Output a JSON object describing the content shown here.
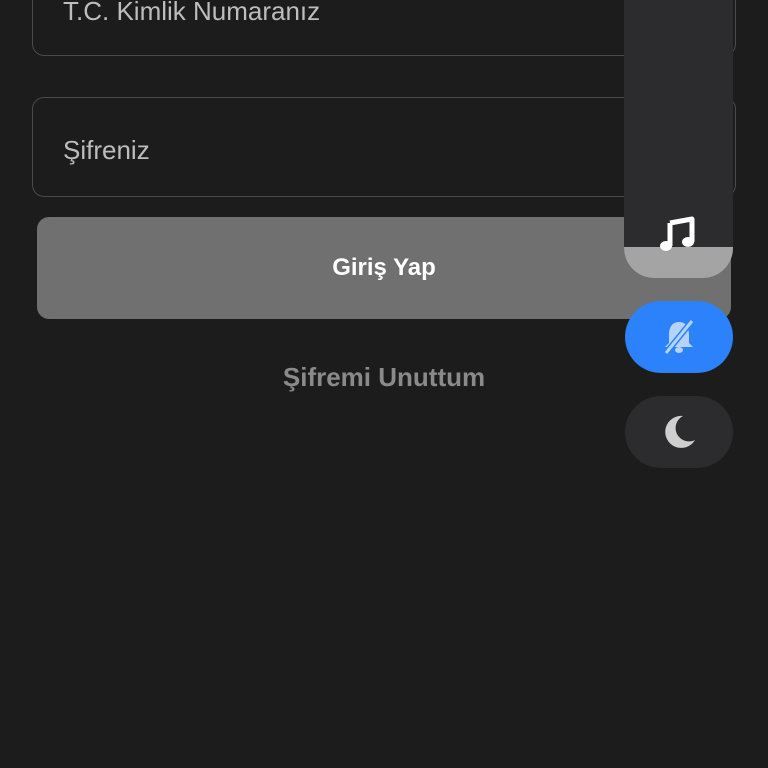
{
  "form": {
    "tc_placeholder": "T.C. Kimlik Numaranız",
    "password_placeholder": "Şifreniz",
    "login_label": "Giriş Yap",
    "forgot_label": "Şifremi Unuttum"
  },
  "sound_panel": {
    "volume_level": 0.1,
    "media_icon": "music-note-icon",
    "mute_icon": "bell-off-icon",
    "mute_active": true,
    "dnd_icon": "moon-icon"
  },
  "colors": {
    "background": "#1c1c1c",
    "login_button": "#707070",
    "active_accent": "#2b82fb",
    "panel": "#2c2c2e"
  }
}
